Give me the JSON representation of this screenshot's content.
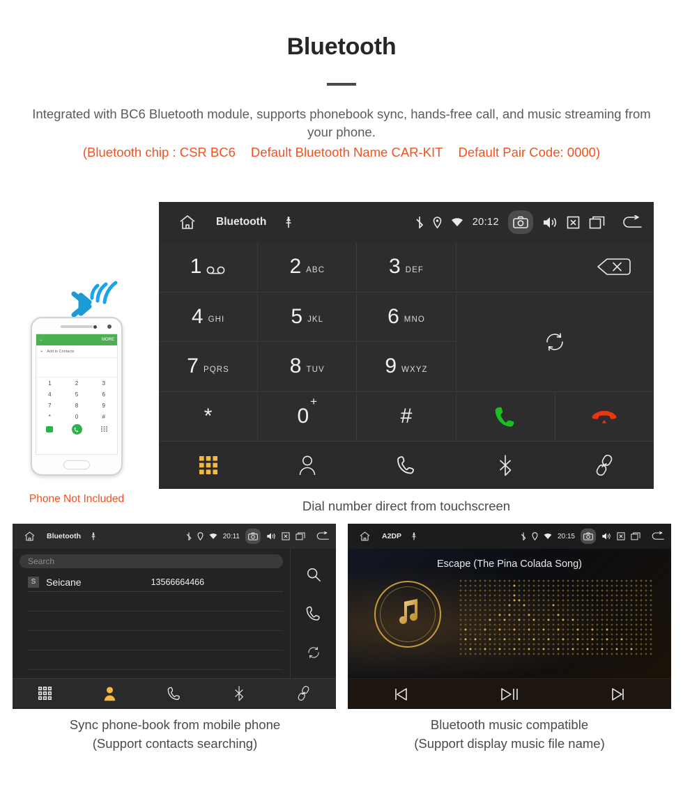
{
  "header": {
    "title": "Bluetooth",
    "description": "Integrated with BC6 Bluetooth module, supports phonebook sync, hands-free call, and music streaming from your phone.",
    "spec_chip": "(Bluetooth chip : CSR BC6",
    "spec_name": "Default Bluetooth Name CAR-KIT",
    "spec_code": "Default Pair Code: 0000)",
    "accent_color": "#f4511e",
    "text_color": "#5b5b5b"
  },
  "phone_mock": {
    "bar_back": "←",
    "bar_more": "MORE",
    "add_contacts": "Add to Contacts",
    "plus": "+",
    "keys": [
      "1",
      "2",
      "3",
      "4",
      "5",
      "6",
      "7",
      "8",
      "9",
      "*",
      "0",
      "#"
    ],
    "not_included": "Phone Not Included"
  },
  "main_screen": {
    "statusbar": {
      "home_icon": "home-icon",
      "title": "Bluetooth",
      "usb_icon": "usb-icon",
      "bluetooth_icon": "bluetooth-icon",
      "location_icon": "location-icon",
      "wifi_icon": "wifi-icon",
      "time": "20:12",
      "camera_icon": "camera-icon",
      "volume_icon": "volume-icon",
      "close_icon": "close-box-icon",
      "recents_icon": "recent-apps-icon",
      "back_icon": "back-arrow-icon"
    },
    "keys": [
      {
        "num": "1",
        "sub": "",
        "voicemail": true
      },
      {
        "num": "2",
        "sub": "ABC"
      },
      {
        "num": "3",
        "sub": "DEF"
      },
      {
        "num": "4",
        "sub": "GHI"
      },
      {
        "num": "5",
        "sub": "JKL"
      },
      {
        "num": "6",
        "sub": "MNO"
      },
      {
        "num": "7",
        "sub": "PQRS"
      },
      {
        "num": "8",
        "sub": "TUV"
      },
      {
        "num": "9",
        "sub": "WXYZ"
      },
      {
        "num": "*",
        "sub": ""
      },
      {
        "num": "0",
        "sub": "",
        "plus": "+"
      },
      {
        "num": "#",
        "sub": ""
      }
    ],
    "actions": {
      "backspace_icon": "backspace-icon",
      "sync_icon": "sync-icon",
      "call_icon": "call-icon",
      "hangup_icon": "hangup-icon",
      "call_color": "#18c020",
      "hangup_color": "#e8360f"
    },
    "navbar": [
      {
        "icon": "dialpad-icon",
        "active": true
      },
      {
        "icon": "contacts-icon",
        "active": false
      },
      {
        "icon": "call-log-icon",
        "active": false
      },
      {
        "icon": "bluetooth-icon",
        "active": false
      },
      {
        "icon": "link-icon",
        "active": false
      }
    ],
    "active_color": "#f5b942",
    "caption": "Dial number direct from touchscreen"
  },
  "contacts_screen": {
    "statusbar": {
      "title": "Bluetooth",
      "time": "20:11"
    },
    "search_placeholder": "Search",
    "contacts": [
      {
        "initial": "S",
        "name": "Seicane",
        "number": "13566664466"
      }
    ],
    "empty_rows": 4,
    "rail": [
      {
        "icon": "search-icon"
      },
      {
        "icon": "call-icon"
      },
      {
        "icon": "sync-icon"
      }
    ],
    "navbar": [
      {
        "icon": "dialpad-icon",
        "active": false
      },
      {
        "icon": "contacts-icon",
        "active": true
      },
      {
        "icon": "call-log-icon",
        "active": false
      },
      {
        "icon": "bluetooth-icon",
        "active": false
      },
      {
        "icon": "link-icon",
        "active": false
      }
    ],
    "active_color": "#f5b942",
    "caption_line1": "Sync phone-book from mobile phone",
    "caption_line2": "(Support contacts searching)"
  },
  "music_screen": {
    "statusbar": {
      "title": "A2DP",
      "time": "20:15"
    },
    "song_title": "Escape (The Pina Colada Song)",
    "album_icon": "music-note-bluetooth-icon",
    "accent_color": "#c79a3c",
    "controls": [
      {
        "icon": "previous-track-icon"
      },
      {
        "icon": "play-pause-icon"
      },
      {
        "icon": "next-track-icon"
      }
    ],
    "caption_line1": "Bluetooth music compatible",
    "caption_line2": "(Support display music file name)"
  }
}
